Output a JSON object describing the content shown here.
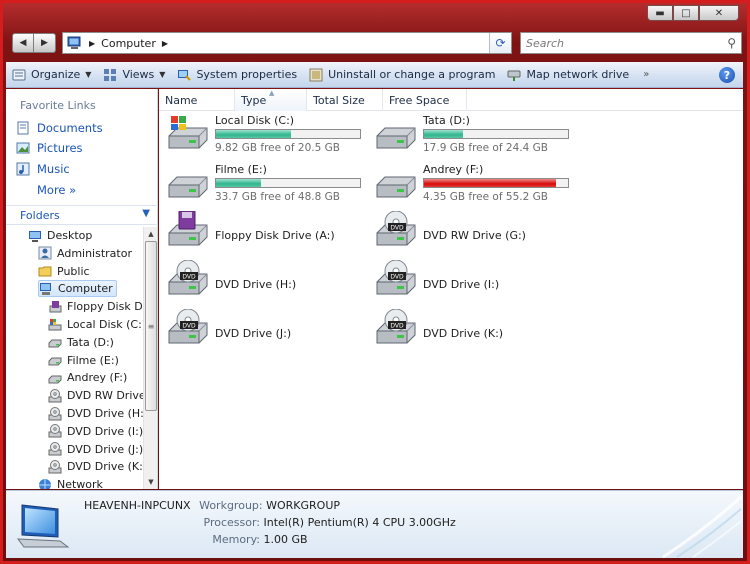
{
  "window": {
    "controls": {
      "minimize": "▬",
      "maximize": "□",
      "close": "✕"
    }
  },
  "nav": {
    "breadcrumb": "Computer",
    "search_placeholder": "Search"
  },
  "toolbar": {
    "organize": "Organize",
    "views": "Views",
    "system_properties": "System properties",
    "uninstall": "Uninstall or change a program",
    "map_drive": "Map network drive",
    "more": "»",
    "help": "?"
  },
  "favorites": {
    "title": "Favorite Links",
    "items": [
      {
        "label": "Documents",
        "icon": "documents-icon"
      },
      {
        "label": "Pictures",
        "icon": "pictures-icon"
      },
      {
        "label": "Music",
        "icon": "music-icon"
      },
      {
        "label": "More »",
        "icon": ""
      }
    ]
  },
  "folders": {
    "title": "Folders",
    "tree": [
      {
        "label": "Desktop",
        "icon": "desktop-icon",
        "level": 0
      },
      {
        "label": "Administrator",
        "icon": "user-icon",
        "level": 1
      },
      {
        "label": "Public",
        "icon": "folder-icon",
        "level": 1
      },
      {
        "label": "Computer",
        "icon": "computer-icon",
        "level": 1,
        "selected": true
      },
      {
        "label": "Floppy Disk Dr",
        "icon": "floppy-icon",
        "level": 2
      },
      {
        "label": "Local Disk (C:)",
        "icon": "windows-disk-icon",
        "level": 2
      },
      {
        "label": "Tata (D:)",
        "icon": "disk-icon",
        "level": 2
      },
      {
        "label": "Filme (E:)",
        "icon": "disk-icon",
        "level": 2
      },
      {
        "label": "Andrey (F:)",
        "icon": "disk-icon",
        "level": 2
      },
      {
        "label": "DVD RW Drive",
        "icon": "dvd-icon",
        "level": 2
      },
      {
        "label": "DVD Drive (H:)",
        "icon": "dvd-icon",
        "level": 2
      },
      {
        "label": "DVD Drive (I:)",
        "icon": "dvd-icon",
        "level": 2
      },
      {
        "label": "DVD Drive (J:)",
        "icon": "dvd-icon",
        "level": 2
      },
      {
        "label": "DVD Drive (K:)",
        "icon": "dvd-icon",
        "level": 2
      },
      {
        "label": "Network",
        "icon": "network-icon",
        "level": 1
      }
    ]
  },
  "columns": [
    "Name",
    "Type",
    "Total Size",
    "Free Space"
  ],
  "drives": [
    {
      "name": "Local Disk (C:)",
      "free": "9.82 GB free of 20.5 GB",
      "used_fraction": 0.52,
      "full": false,
      "kind": "hdd-win"
    },
    {
      "name": "Tata (D:)",
      "free": "17.9 GB free of 24.4 GB",
      "used_fraction": 0.27,
      "full": false,
      "kind": "hdd"
    },
    {
      "name": "Filme (E:)",
      "free": "33.7 GB free of 48.8 GB",
      "used_fraction": 0.31,
      "full": false,
      "kind": "hdd"
    },
    {
      "name": "Andrey (F:)",
      "free": "4.35 GB free of 55.2 GB",
      "used_fraction": 0.92,
      "full": true,
      "kind": "hdd"
    },
    {
      "name": "Floppy Disk Drive (A:)",
      "kind": "floppy"
    },
    {
      "name": "DVD RW Drive (G:)",
      "kind": "dvd"
    },
    {
      "name": "DVD Drive (H:)",
      "kind": "dvd"
    },
    {
      "name": "DVD Drive (I:)",
      "kind": "dvd"
    },
    {
      "name": "DVD Drive (J:)",
      "kind": "dvd"
    },
    {
      "name": "DVD Drive (K:)",
      "kind": "dvd"
    }
  ],
  "details": {
    "computer_name": "HEAVENH-INPCUNX",
    "workgroup_label": "Workgroup:",
    "workgroup": "WORKGROUP",
    "processor_label": "Processor:",
    "processor": "Intel(R) Pentium(R) 4 CPU 3.00GHz",
    "memory_label": "Memory:",
    "memory": "1.00 GB"
  },
  "colors": {
    "frame": "#d61d1d",
    "link": "#1b55b5",
    "bar_ok": "#2fb58c",
    "bar_full": "#d40b0b"
  }
}
